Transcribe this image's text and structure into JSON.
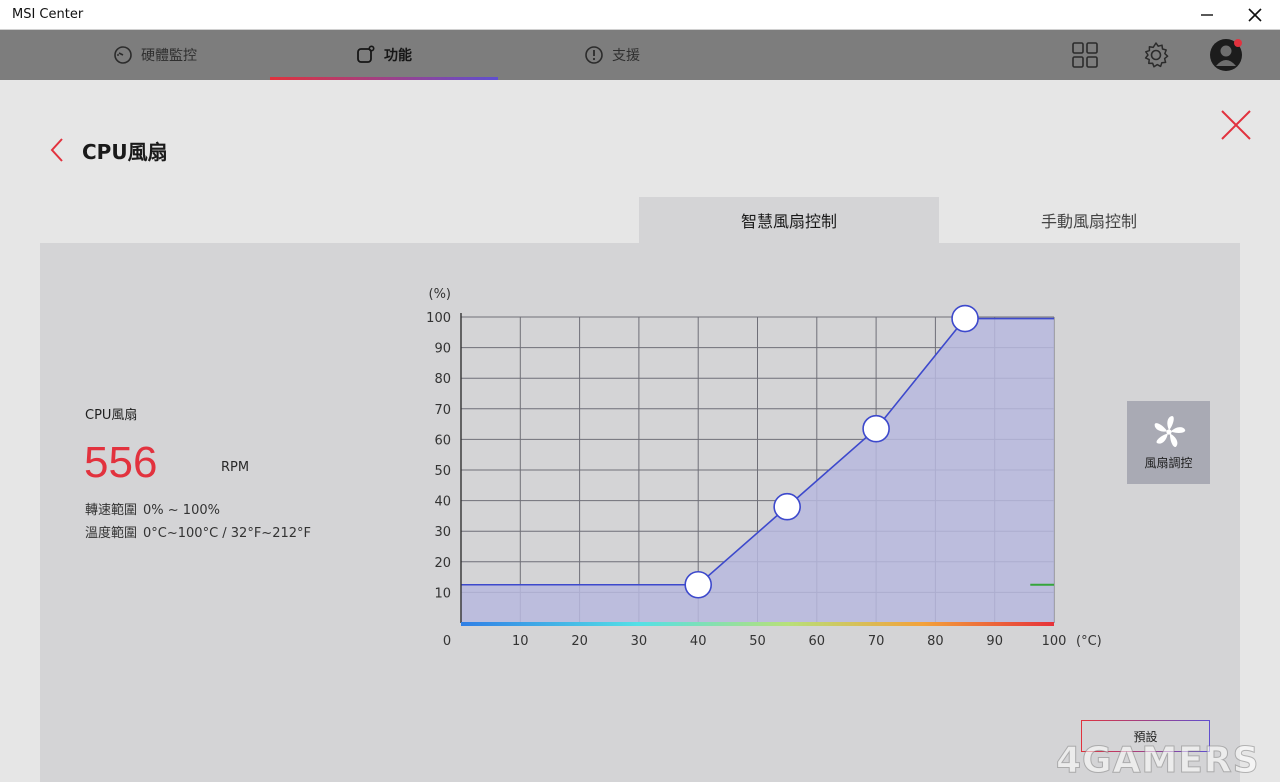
{
  "window": {
    "title": "MSI Center"
  },
  "nav": {
    "tabs": [
      {
        "label": "硬體監控",
        "icon": "gauge-icon"
      },
      {
        "label": "功能",
        "icon": "feature-icon",
        "active": true
      },
      {
        "label": "支援",
        "icon": "support-icon"
      }
    ]
  },
  "page": {
    "title": "CPU風扇"
  },
  "mode_tabs": [
    {
      "label": "智慧風扇控制",
      "active": true
    },
    {
      "label": "手動風扇控制"
    }
  ],
  "fan": {
    "name": "CPU風扇",
    "rpm": "556",
    "rpm_unit": "RPM",
    "speed_range_label": "轉速範圍",
    "speed_range_value": "0% ~ 100%",
    "temp_range_label": "溫度範圍",
    "temp_range_value": "0°C~100°C / 32°F~212°F"
  },
  "chart_data": {
    "type": "line",
    "ylabel": "(%)",
    "xlabel": "(°C)",
    "x_ticks": [
      "0",
      "10",
      "20",
      "30",
      "40",
      "50",
      "60",
      "70",
      "80",
      "90",
      "100"
    ],
    "y_ticks": [
      "10",
      "20",
      "30",
      "40",
      "50",
      "60",
      "70",
      "80",
      "90",
      "100"
    ],
    "xlim": [
      0,
      100
    ],
    "ylim": [
      0,
      100
    ],
    "grid": true,
    "series": [
      {
        "points": [
          [
            0,
            12.5
          ],
          [
            40,
            12.5
          ],
          [
            55,
            38
          ],
          [
            70,
            63.5
          ],
          [
            85,
            99.5
          ],
          [
            100,
            99.5
          ]
        ]
      }
    ],
    "control_points": [
      [
        40,
        12.5
      ],
      [
        55,
        38
      ],
      [
        70,
        63.5
      ],
      [
        85,
        99.5
      ]
    ],
    "current_marker": [
      [
        96,
        12.5
      ],
      [
        100,
        12.5
      ]
    ],
    "colors": {
      "line": "#3d49cc",
      "fill": "#b7b9de",
      "marker": "#35a53b"
    }
  },
  "fan_control_button": {
    "label": "風扇調控",
    "icon": "fan-icon"
  },
  "default_button": {
    "label": "預設"
  },
  "watermark": "4GAMERS"
}
